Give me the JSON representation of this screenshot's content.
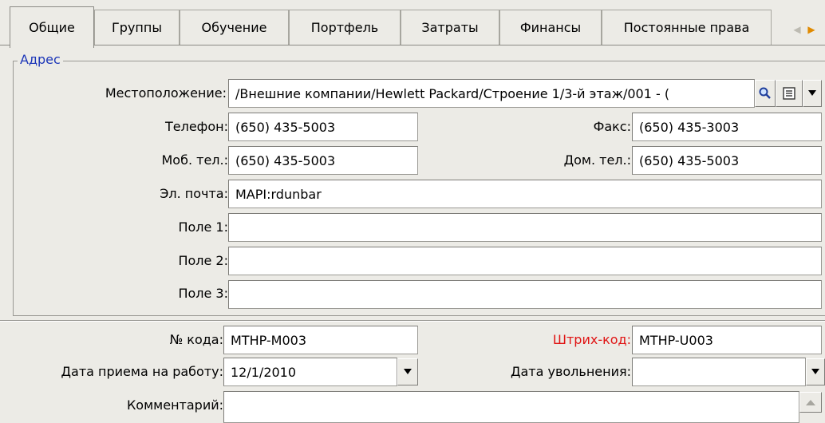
{
  "tabs": [
    "Общие",
    "Группы",
    "Обучение",
    "Портфель",
    "Затраты",
    "Финансы",
    "Постоянные права"
  ],
  "address_group": {
    "legend": "Адрес",
    "location_label": "Местоположение:",
    "location_value": "/Внешние компании/Hewlett Packard/Строение 1/3-й этаж/001 - (",
    "phone_label": "Телефон:",
    "phone_value": "(650) 435-5003",
    "fax_label": "Факс:",
    "fax_value": "(650) 435-3003",
    "mobile_label": "Моб. тел.:",
    "mobile_value": "(650) 435-5003",
    "home_label": "Дом. тел.:",
    "home_value": "(650) 435-5003",
    "email_label": "Эл. почта:",
    "email_value": "MAPI:rdunbar",
    "field1_label": "Поле 1:",
    "field1_value": "",
    "field2_label": "Поле 2:",
    "field2_value": "",
    "field3_label": "Поле 3:",
    "field3_value": ""
  },
  "code_label": "№ кода:",
  "code_value": "MTHP-M003",
  "barcode_label": "Штрих-код:",
  "barcode_value": "MTHP-U003",
  "hire_date_label": "Дата приема на работу:",
  "hire_date_value": "12/1/2010",
  "termination_label": "Дата увольнения:",
  "termination_value": "",
  "comment_label": "Комментарий:",
  "comment_value": "",
  "colors": {
    "accent_legend": "#1c36b8",
    "barcode_label": "#e01414",
    "tab_scroll_arrow": "#e08a00"
  },
  "icons": {
    "lookup": "magnifier-icon",
    "details": "form-icon",
    "dropdown": "triangle-down-icon"
  }
}
